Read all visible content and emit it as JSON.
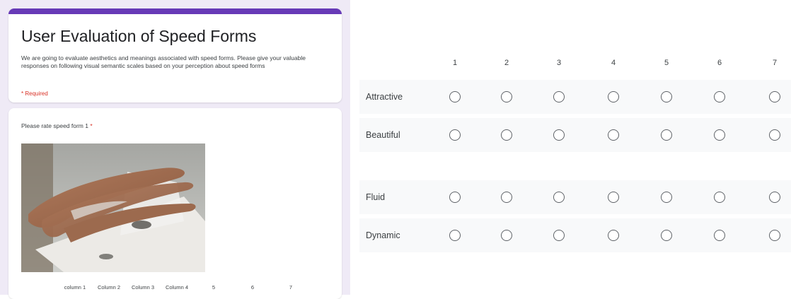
{
  "form": {
    "title": "User Evaluation of Speed Forms",
    "description": "We are going to evaluate aesthetics and meanings associated with speed forms. Please give your valuable responses on following visual semantic scales based on your perception about speed forms",
    "required_note": "* Required"
  },
  "question": {
    "label": "Please rate speed form 1",
    "required_mark": "*",
    "small_columns": [
      "column 1",
      "Column 2",
      "Column 3",
      "Column 4",
      "5",
      "6",
      "7"
    ]
  },
  "grid": {
    "columns": [
      "1",
      "2",
      "3",
      "4",
      "5",
      "6",
      "7"
    ],
    "rows": [
      {
        "label": "Attractive"
      },
      {
        "label": "Beautiful"
      },
      {
        "label": "Fluid"
      },
      {
        "label": "Dynamic"
      }
    ]
  },
  "colors": {
    "accent": "#673ab7",
    "required": "#d93025",
    "background": "#efeaf6"
  }
}
